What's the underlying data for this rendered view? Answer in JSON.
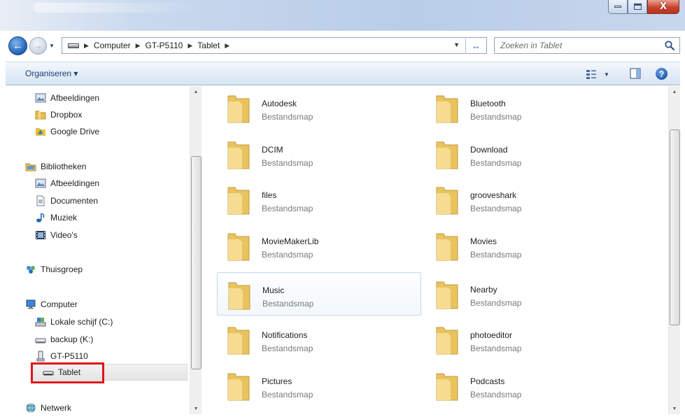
{
  "window": {
    "minimize_label": "minimize",
    "maximize_label": "maximize",
    "close_glyph": "X"
  },
  "address_bar": {
    "crumbs": [
      "Computer",
      "GT-P5110",
      "Tablet"
    ],
    "drive_icon": "drive-icon"
  },
  "search": {
    "placeholder": "Zoeken in Tablet"
  },
  "toolbar": {
    "organize_label": "Organiseren ▾",
    "help_glyph": "?"
  },
  "nav": {
    "items": [
      {
        "label": "Afbeeldingen",
        "icon": "pictures-icon"
      },
      {
        "label": "Dropbox",
        "icon": "folder-icon"
      },
      {
        "label": "Google Drive",
        "icon": "google-drive-icon"
      },
      {
        "label": "Bibliotheken",
        "icon": "libraries-icon"
      },
      {
        "label": "Afbeeldingen",
        "icon": "pictures-icon"
      },
      {
        "label": "Documenten",
        "icon": "documents-icon"
      },
      {
        "label": "Muziek",
        "icon": "music-icon"
      },
      {
        "label": "Video's",
        "icon": "video-icon"
      },
      {
        "label": "Thuisgroep",
        "icon": "homegroup-icon"
      },
      {
        "label": "Computer",
        "icon": "computer-icon"
      },
      {
        "label": "Lokale schijf (C:)",
        "icon": "local-disk-icon"
      },
      {
        "label": "backup (K:)",
        "icon": "drive-icon"
      },
      {
        "label": "GT-P5110",
        "icon": "device-icon"
      },
      {
        "label": "Tablet",
        "icon": "drive-icon"
      },
      {
        "label": "Netwerk",
        "icon": "network-icon"
      }
    ]
  },
  "folders": {
    "type_label": "Bestandsmap",
    "items": [
      "Autodesk",
      "Bluetooth",
      "DCIM",
      "Download",
      "files",
      "grooveshark",
      "MovieMakerLib",
      "Movies",
      "Music",
      "Nearby",
      "Notifications",
      "photoeditor",
      "Pictures",
      "Podcasts"
    ]
  },
  "colors": {
    "highlight": "#e3141a",
    "folder": "#f0cf6a"
  }
}
